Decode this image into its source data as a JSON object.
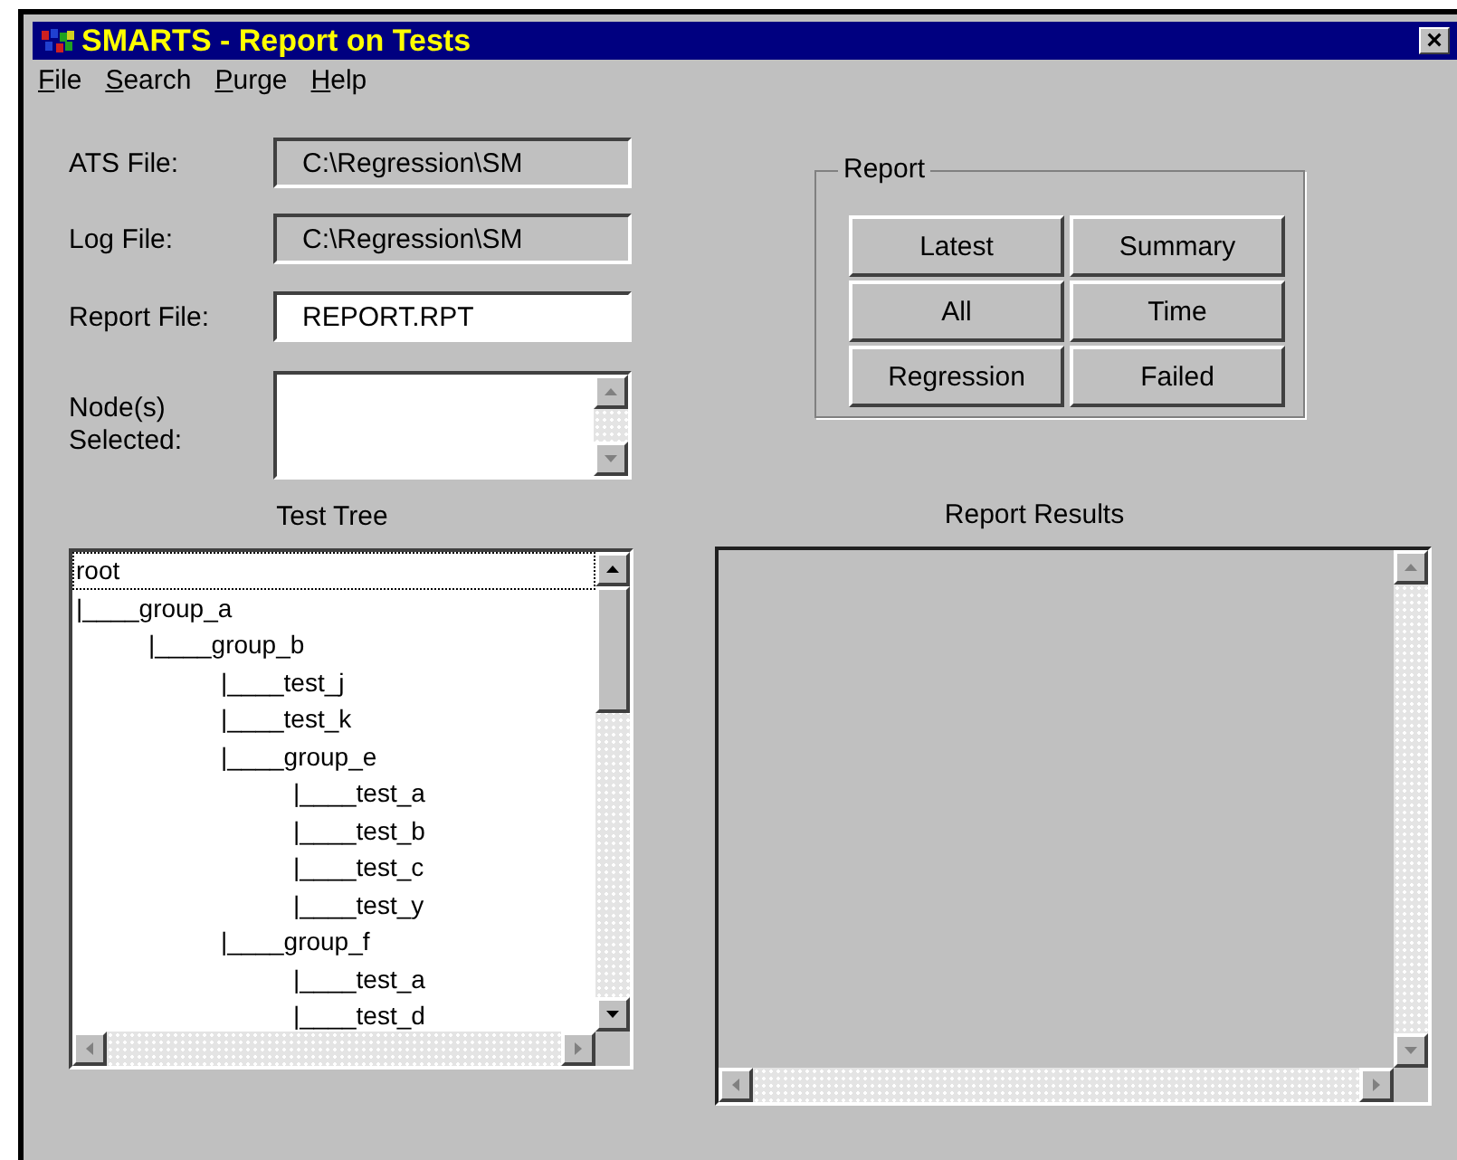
{
  "window": {
    "title": "SMARTS - Report on Tests",
    "close_label": "×"
  },
  "menu": [
    {
      "label": "File"
    },
    {
      "label": "Search"
    },
    {
      "label": "Purge"
    },
    {
      "label": "Help"
    }
  ],
  "fields": [
    {
      "label": "ATS File:",
      "value": "C:\\Regression\\SM",
      "kind": "readonly"
    },
    {
      "label": "Log File:",
      "value": "C:\\Regression\\SM",
      "kind": "readonly"
    },
    {
      "label": "Report File:",
      "value": "REPORT.RPT",
      "kind": "editable"
    },
    {
      "label": "Node(s) Selected:",
      "kind": "list"
    }
  ],
  "report_group": {
    "title": "Report",
    "buttons": [
      "Latest",
      "Summary",
      "All",
      "Time",
      "Regression",
      "Failed"
    ]
  },
  "test_tree": {
    "title": "Test Tree",
    "nodes": [
      {
        "label": "root",
        "selected": true,
        "children": [
          {
            "label": "|____group_a",
            "selected": false,
            "children": [
              {
                "label": "|____group_b",
                "selected": false,
                "children": [
                  {
                    "label": "|____test_j",
                    "selected": false
                  },
                  {
                    "label": "|____test_k",
                    "selected": false
                  },
                  {
                    "label": "|____group_e",
                    "selected": false,
                    "children": [
                      {
                        "label": "|____test_a",
                        "selected": false
                      },
                      {
                        "label": "|____test_b",
                        "selected": false
                      },
                      {
                        "label": "|____test_c",
                        "selected": false
                      },
                      {
                        "label": "|____test_y",
                        "selected": false
                      }
                    ]
                  },
                  {
                    "label": "|____group_f",
                    "selected": false,
                    "children": [
                      {
                        "label": "|____test_a",
                        "selected": false
                      },
                      {
                        "label": "|____test_d",
                        "selected": false
                      }
                    ]
                  }
                ]
              }
            ]
          }
        ]
      }
    ]
  },
  "report_results": {
    "title": "Report Results"
  }
}
